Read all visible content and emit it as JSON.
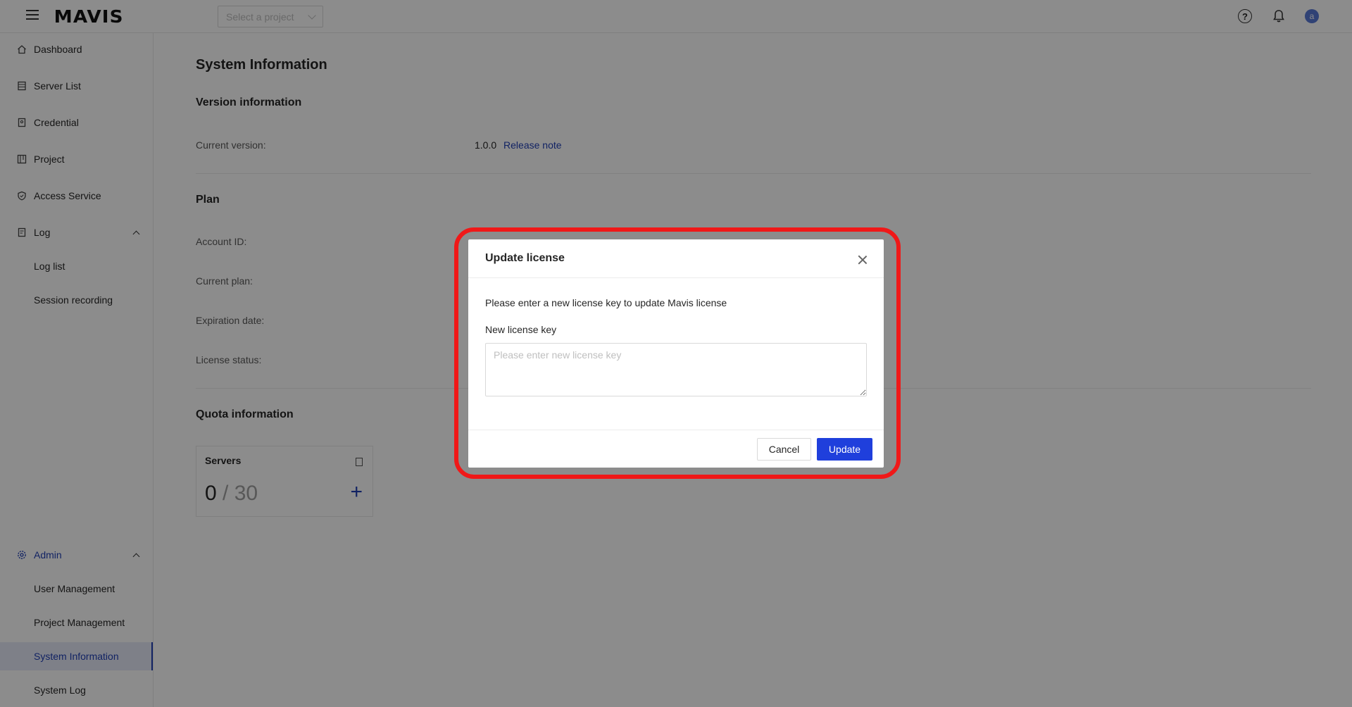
{
  "header": {
    "logo": "MAVIS",
    "project_select_placeholder": "Select a project",
    "avatar_initial": "a"
  },
  "sidebar": {
    "items": [
      {
        "label": "Dashboard",
        "icon": "home-icon"
      },
      {
        "label": "Server List",
        "icon": "server-icon"
      },
      {
        "label": "Credential",
        "icon": "credential-icon"
      },
      {
        "label": "Project",
        "icon": "project-icon"
      },
      {
        "label": "Access Service",
        "icon": "shield-icon"
      },
      {
        "label": "Log",
        "icon": "log-icon"
      },
      {
        "label": "Log list"
      },
      {
        "label": "Session recording"
      },
      {
        "label": "Admin",
        "icon": "gear-icon"
      },
      {
        "label": "User Management"
      },
      {
        "label": "Project Management"
      },
      {
        "label": "System Information"
      },
      {
        "label": "System Log"
      }
    ],
    "active_item": "System Information"
  },
  "main": {
    "title": "System Information",
    "version_section": {
      "title": "Version information",
      "current_version_label": "Current version",
      "current_version_value": "1.0.0",
      "release_note_link": "Release note"
    },
    "plan_section": {
      "title": "Plan",
      "account_id_label": "Account ID",
      "current_plan_label": "Current plan",
      "expiration_date_label": "Expiration date",
      "license_status_label": "License status"
    },
    "quota_section": {
      "title": "Quota information",
      "servers_title": "Servers",
      "servers_used": "0",
      "servers_separator": "/",
      "servers_total": "30"
    }
  },
  "modal": {
    "title": "Update license",
    "description": "Please enter a new license key to update Mavis license",
    "field_label": "New license key",
    "field_placeholder": "Please enter new license key",
    "field_value": "",
    "cancel_label": "Cancel",
    "update_label": "Update"
  },
  "colors": {
    "accent": "#1f3fdc",
    "highlight": "#f01818"
  }
}
